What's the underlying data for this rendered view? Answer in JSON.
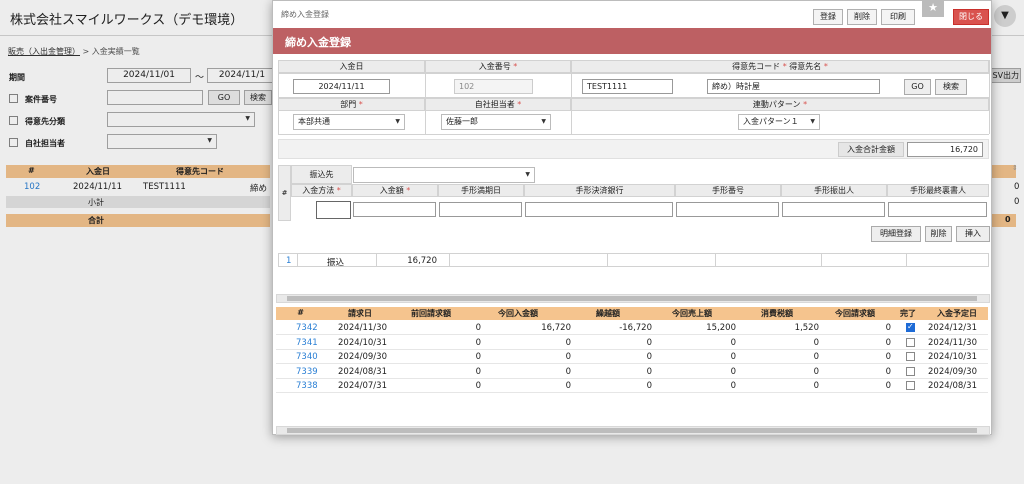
{
  "app": {
    "title": "株式会社スマイルワークス（デモ環境）",
    "breadcrumb_link": "販売（入出金管理）",
    "breadcrumb_sep": ">",
    "breadcrumb_current": "入金実績一覧"
  },
  "search": {
    "period_label": "期間",
    "period_from": "2024/11/01",
    "period_tilde": "〜",
    "period_to": "2024/11/1",
    "case_label": "案件番号",
    "customer_class_label": "得意先分類",
    "own_staff_label": "自社担当者",
    "go_label": "GO",
    "search_label": "検索",
    "csv_label": "CSV出力"
  },
  "bg_table": {
    "headers": [
      "#",
      "入金日",
      "得意先コード"
    ],
    "row": {
      "no": "102",
      "date": "2024/11/11",
      "code": "TEST1111",
      "name": "締め"
    },
    "subtotal_label": "小計",
    "total_label": "合計",
    "right_values": [
      "0",
      "0",
      "0"
    ]
  },
  "modal": {
    "window_title": "締め入金登録",
    "header_title": "締め入金登録",
    "toolbar": {
      "register": "登録",
      "delete": "削除",
      "print": "印刷",
      "close": "閉じる"
    },
    "form": {
      "deposit_date_label": "入金日",
      "deposit_date": "2024/11/11",
      "deposit_no_label": "入金番号",
      "deposit_no": "102",
      "customer_label": "得意先コード",
      "customer_name_label": "得意先名",
      "customer_code": "TEST1111",
      "customer_name": "締め）時計屋",
      "go_label": "GO",
      "search_label": "検索",
      "dept_label": "部門",
      "dept": "本部共通",
      "staff_label": "自社担当者",
      "staff": "佐藤一郎",
      "pattern_label": "連動パターン",
      "pattern": "入金パターン１",
      "req": "*"
    },
    "total": {
      "label": "入金合計金額",
      "value": "16,720"
    },
    "detail": {
      "hash": "#",
      "transfer_label": "振込先",
      "headers": [
        "入金方法",
        "入金額",
        "手形満期日",
        "手形決済銀行",
        "手形番号",
        "手形振出人",
        "手形最終裏書人"
      ],
      "btn_register": "明細登録",
      "btn_delete": "削除",
      "btn_insert": "挿入",
      "row": {
        "no": "1",
        "method": "振込",
        "amount": "16,720"
      }
    },
    "result": {
      "headers": [
        "#",
        "請求日",
        "前回請求額",
        "今回入金額",
        "繰越額",
        "今回売上額",
        "消費税額",
        "今回請求額",
        "完了",
        "入金予定日"
      ],
      "rows": [
        {
          "no": "7342",
          "date": "2024/11/30",
          "prev": "0",
          "paid": "16,720",
          "carry": "-16,720",
          "sales": "15,200",
          "tax": "1,520",
          "bill": "0",
          "done": true,
          "due": "2024/12/31"
        },
        {
          "no": "7341",
          "date": "2024/10/31",
          "prev": "0",
          "paid": "0",
          "carry": "0",
          "sales": "0",
          "tax": "0",
          "bill": "0",
          "done": false,
          "due": "2024/11/30"
        },
        {
          "no": "7340",
          "date": "2024/09/30",
          "prev": "0",
          "paid": "0",
          "carry": "0",
          "sales": "0",
          "tax": "0",
          "bill": "0",
          "done": false,
          "due": "2024/10/31"
        },
        {
          "no": "7339",
          "date": "2024/08/31",
          "prev": "0",
          "paid": "0",
          "carry": "0",
          "sales": "0",
          "tax": "0",
          "bill": "0",
          "done": false,
          "due": "2024/09/30"
        },
        {
          "no": "7338",
          "date": "2024/07/31",
          "prev": "0",
          "paid": "0",
          "carry": "0",
          "sales": "0",
          "tax": "0",
          "bill": "0",
          "done": false,
          "due": "2024/08/31"
        }
      ]
    }
  },
  "colors": {
    "header_band": "#bd6063",
    "table_header": "#f5c48e",
    "close_button": "#d9534f",
    "link": "#2a7fd4"
  }
}
